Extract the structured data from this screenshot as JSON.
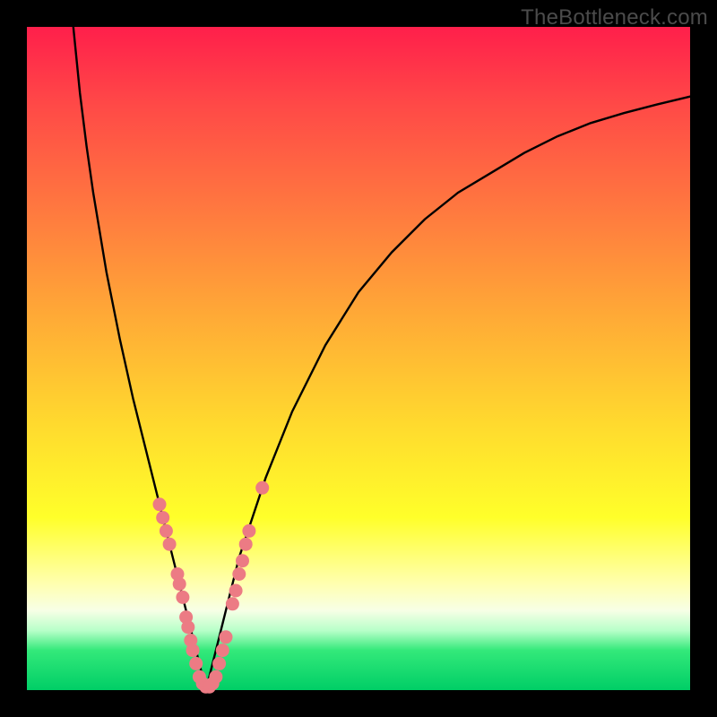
{
  "watermark": "TheBottleneck.com",
  "chart_data": {
    "type": "line",
    "title": "",
    "xlabel": "",
    "ylabel": "",
    "xlim": [
      0,
      100
    ],
    "ylim": [
      0,
      100
    ],
    "series": [
      {
        "name": "bottleneck-curve-left",
        "x": [
          7,
          8,
          9,
          10,
          12,
          14,
          16,
          18,
          20,
          21,
          22,
          23,
          24,
          25,
          26,
          27
        ],
        "y": [
          100,
          90,
          82,
          75,
          63,
          53,
          44,
          36,
          28,
          24,
          20,
          16,
          12,
          8,
          4,
          0
        ]
      },
      {
        "name": "bottleneck-curve-right",
        "x": [
          27,
          28,
          30,
          32,
          34,
          36,
          40,
          45,
          50,
          55,
          60,
          65,
          70,
          75,
          80,
          85,
          90,
          95,
          100
        ],
        "y": [
          0,
          4,
          12,
          20,
          26,
          32,
          42,
          52,
          60,
          66,
          71,
          75,
          78,
          81,
          83.5,
          85.5,
          87,
          88.3,
          89.5
        ]
      }
    ],
    "markers": [
      {
        "x": 20.0,
        "y": 28.0
      },
      {
        "x": 20.5,
        "y": 26.0
      },
      {
        "x": 21.0,
        "y": 24.0
      },
      {
        "x": 21.5,
        "y": 22.0
      },
      {
        "x": 22.7,
        "y": 17.5
      },
      {
        "x": 23.0,
        "y": 16.0
      },
      {
        "x": 23.5,
        "y": 14.0
      },
      {
        "x": 24.0,
        "y": 11.0
      },
      {
        "x": 24.3,
        "y": 9.5
      },
      {
        "x": 24.7,
        "y": 7.5
      },
      {
        "x": 25.0,
        "y": 6.0
      },
      {
        "x": 25.5,
        "y": 4.0
      },
      {
        "x": 26.0,
        "y": 2.0
      },
      {
        "x": 26.5,
        "y": 1.0
      },
      {
        "x": 27.0,
        "y": 0.5
      },
      {
        "x": 27.5,
        "y": 0.5
      },
      {
        "x": 28.0,
        "y": 1.0
      },
      {
        "x": 28.5,
        "y": 2.0
      },
      {
        "x": 29.0,
        "y": 4.0
      },
      {
        "x": 29.5,
        "y": 6.0
      },
      {
        "x": 30.0,
        "y": 8.0
      },
      {
        "x": 31.0,
        "y": 13.0
      },
      {
        "x": 31.5,
        "y": 15.0
      },
      {
        "x": 32.0,
        "y": 17.5
      },
      {
        "x": 32.5,
        "y": 19.5
      },
      {
        "x": 33.0,
        "y": 22.0
      },
      {
        "x": 33.5,
        "y": 24.0
      },
      {
        "x": 35.5,
        "y": 30.5
      }
    ],
    "marker_color": "#ec7b84",
    "curve_color": "#000000"
  }
}
